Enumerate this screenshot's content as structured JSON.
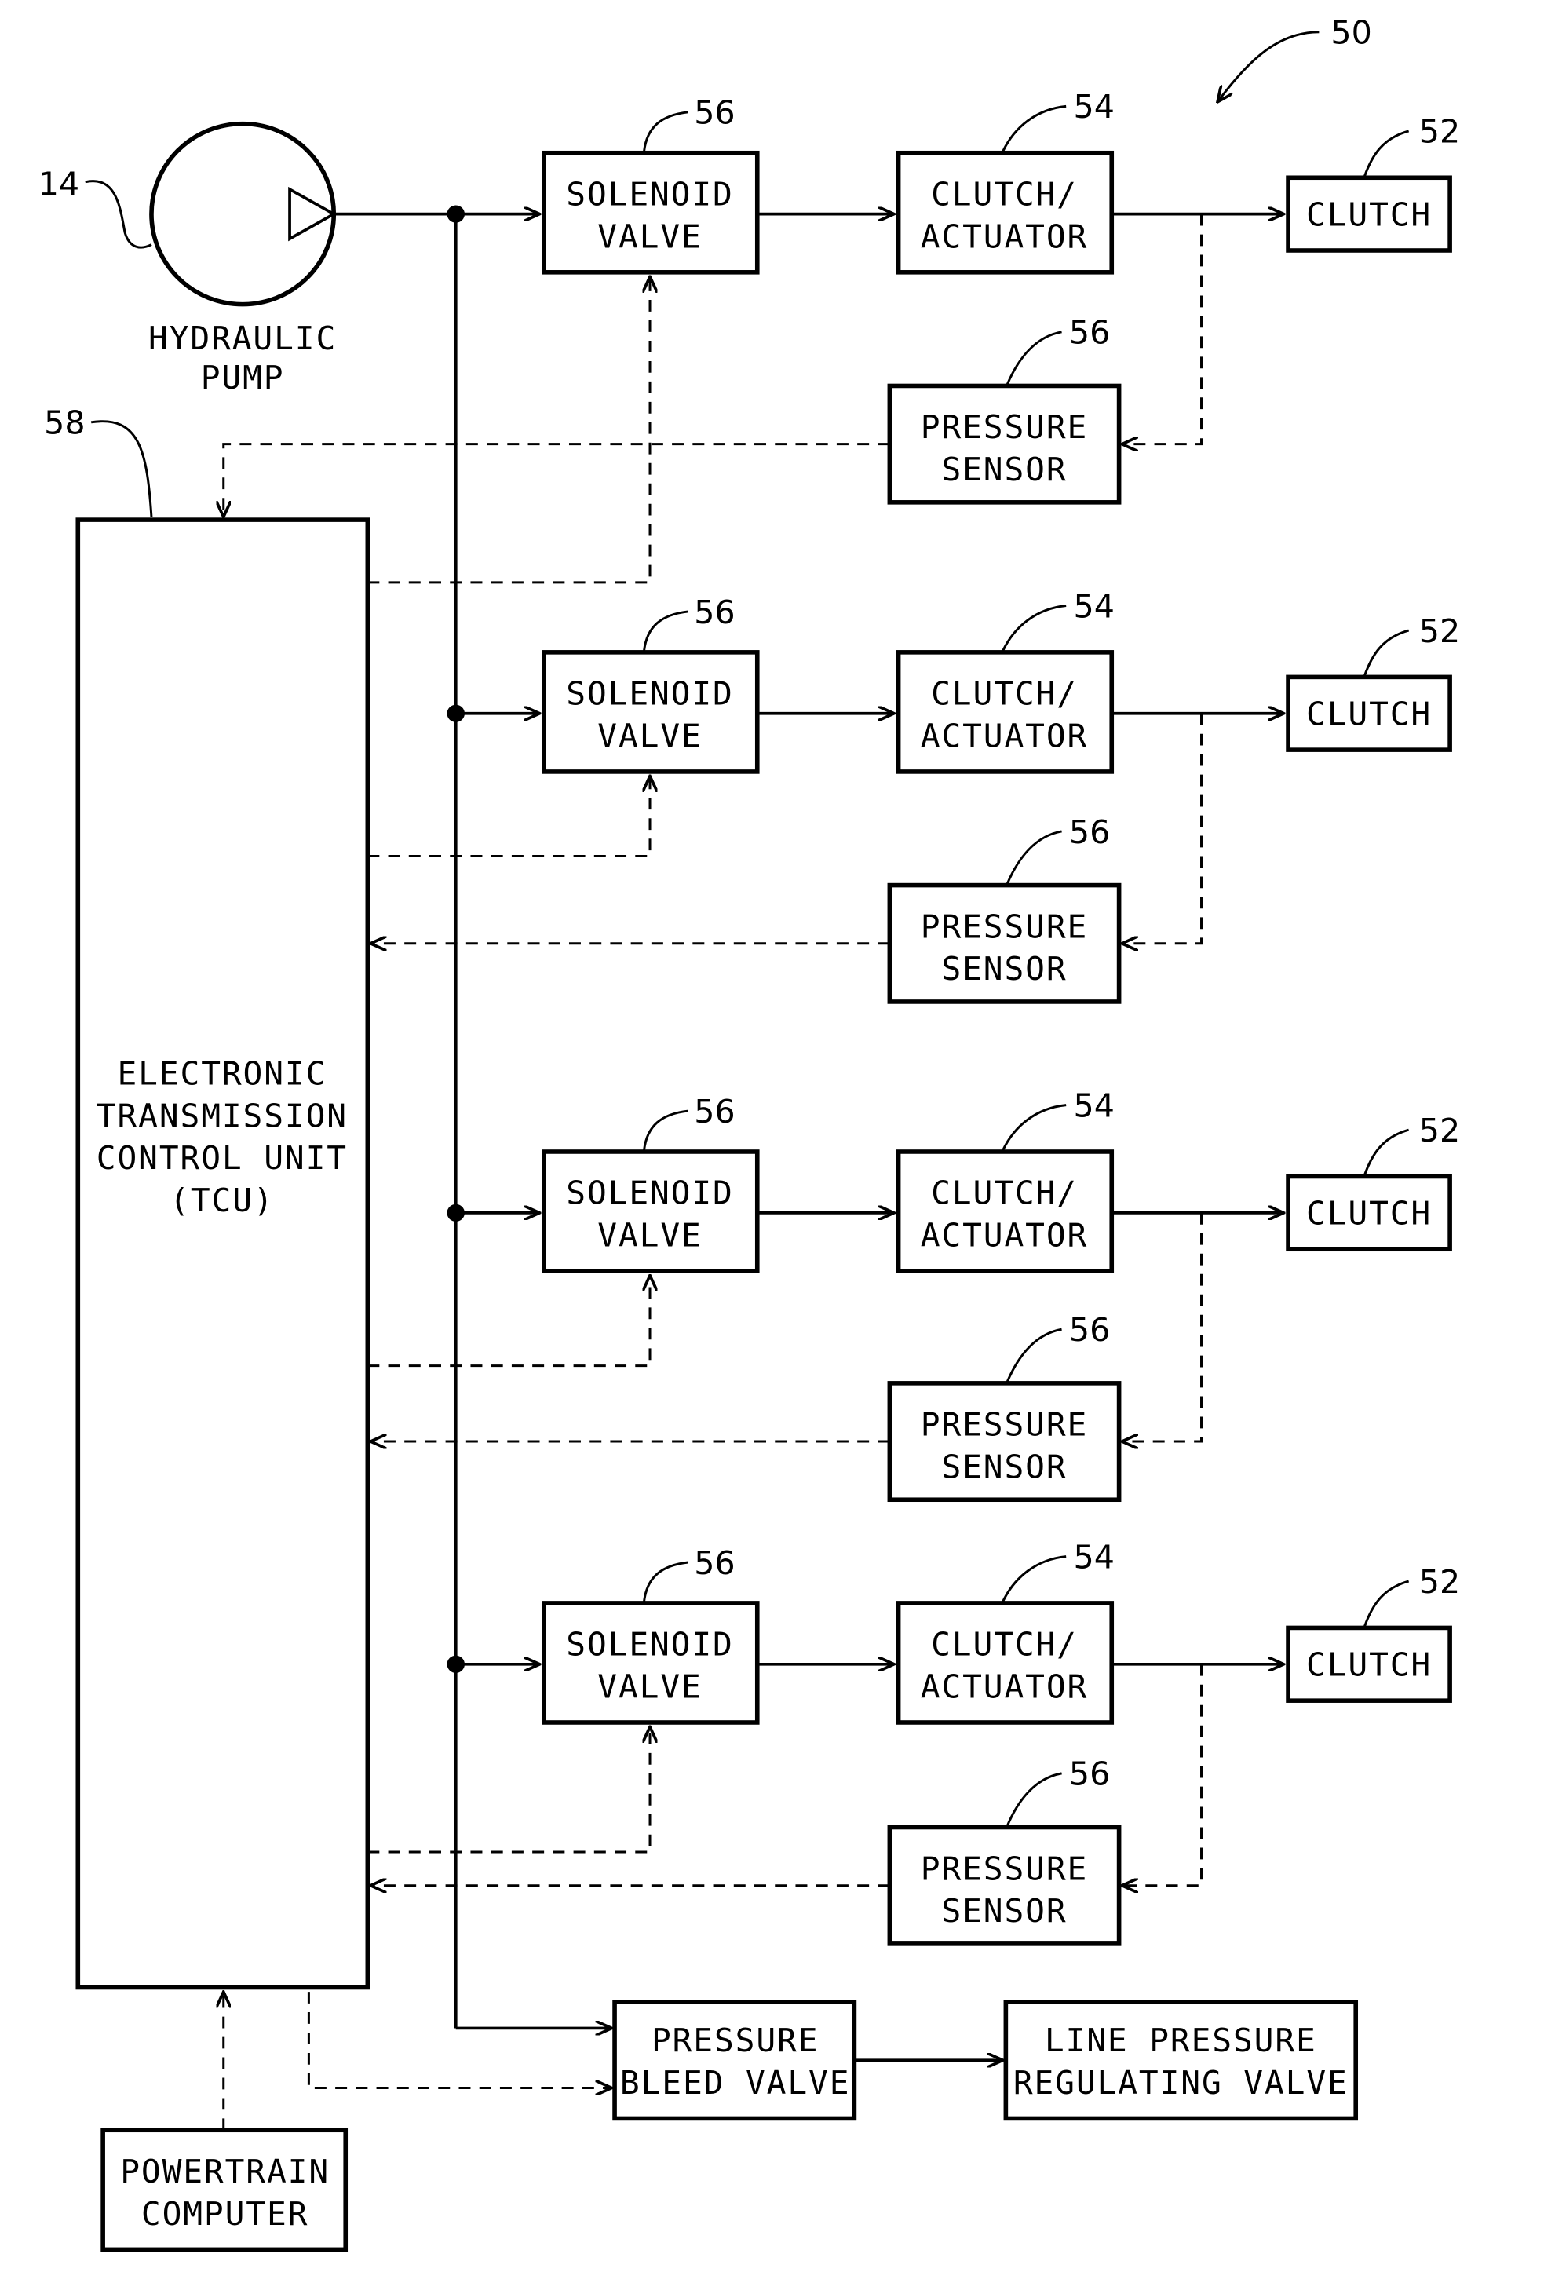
{
  "figure_ref": "50",
  "pump": {
    "ref": "14",
    "label_line1": "HYDRAULIC",
    "label_line2": "PUMP"
  },
  "tcu": {
    "ref": "58",
    "lines": [
      "ELECTRONIC",
      "TRANSMISSION",
      "CONTROL UNIT",
      "(TCU)"
    ]
  },
  "channels": [
    {
      "solenoid": {
        "ref": "56",
        "l1": "SOLENOID",
        "l2": "VALVE"
      },
      "actuator": {
        "ref": "54",
        "l1": "CLUTCH/",
        "l2": "ACTUATOR"
      },
      "clutch": {
        "ref": "52",
        "l1": "CLUTCH"
      },
      "sensor": {
        "ref": "56",
        "l1": "PRESSURE",
        "l2": "SENSOR"
      }
    },
    {
      "solenoid": {
        "ref": "56",
        "l1": "SOLENOID",
        "l2": "VALVE"
      },
      "actuator": {
        "ref": "54",
        "l1": "CLUTCH/",
        "l2": "ACTUATOR"
      },
      "clutch": {
        "ref": "52",
        "l1": "CLUTCH"
      },
      "sensor": {
        "ref": "56",
        "l1": "PRESSURE",
        "l2": "SENSOR"
      }
    },
    {
      "solenoid": {
        "ref": "56",
        "l1": "SOLENOID",
        "l2": "VALVE"
      },
      "actuator": {
        "ref": "54",
        "l1": "CLUTCH/",
        "l2": "ACTUATOR"
      },
      "clutch": {
        "ref": "52",
        "l1": "CLUTCH"
      },
      "sensor": {
        "ref": "56",
        "l1": "PRESSURE",
        "l2": "SENSOR"
      }
    },
    {
      "solenoid": {
        "ref": "56",
        "l1": "SOLENOID",
        "l2": "VALVE"
      },
      "actuator": {
        "ref": "54",
        "l1": "CLUTCH/",
        "l2": "ACTUATOR"
      },
      "clutch": {
        "ref": "52",
        "l1": "CLUTCH"
      },
      "sensor": {
        "ref": "56",
        "l1": "PRESSURE",
        "l2": "SENSOR"
      }
    }
  ],
  "bleed_valve": {
    "l1": "PRESSURE",
    "l2": "BLEED VALVE"
  },
  "line_regulator": {
    "l1": "LINE PRESSURE",
    "l2": "REGULATING VALVE"
  },
  "powertrain": {
    "l1": "POWERTRAIN",
    "l2": "COMPUTER"
  }
}
